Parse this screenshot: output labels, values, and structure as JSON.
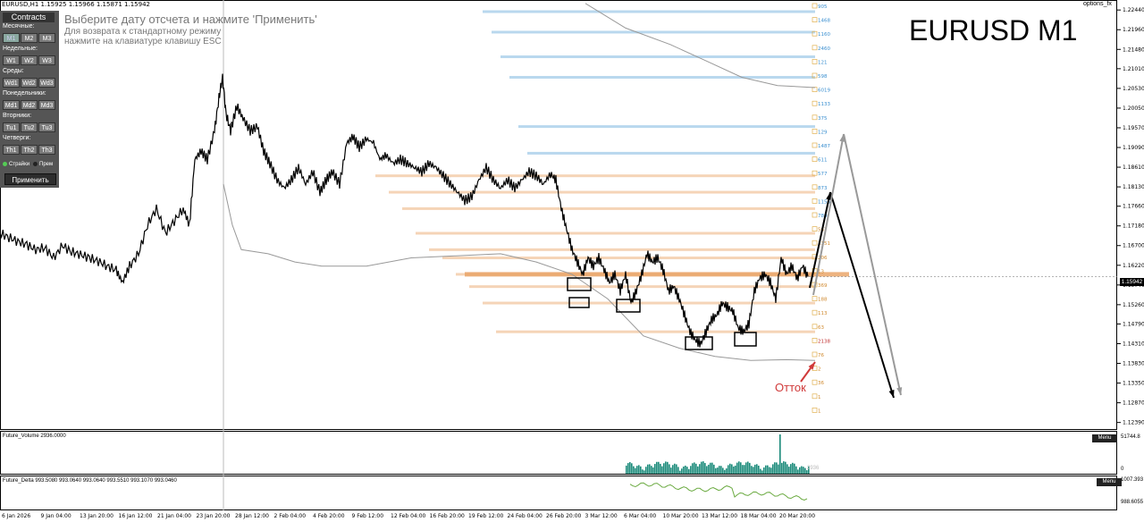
{
  "header": {
    "symbol_line": "EURUSD,H1  1.15925 1.15966 1.15871 1.15942",
    "notice_title": "Выберите дату отсчета и нажмите 'Применить'",
    "notice_line2": "Для возврата к стандартному режиму",
    "notice_line3": "нажмите на клавиатуре клавишу ESC",
    "watermark": "EURUSD M1",
    "options_label": "options_fx"
  },
  "panel": {
    "title": "Contracts",
    "groups": [
      {
        "label": "Месячные:",
        "buttons": [
          "M1",
          "M2",
          "M3"
        ],
        "selected": 0
      },
      {
        "label": "Недельные:",
        "buttons": [
          "W1",
          "W2",
          "W3"
        ],
        "selected": -1
      },
      {
        "label": "Среды:",
        "buttons": [
          "Wd1",
          "Wd2",
          "Wd3"
        ],
        "selected": -1
      },
      {
        "label": "Понедельники:",
        "buttons": [
          "Md1",
          "Md2",
          "Md3"
        ],
        "selected": -1
      },
      {
        "label": "Вторники:",
        "buttons": [
          "Tu1",
          "Tu2",
          "Tu3"
        ],
        "selected": -1
      },
      {
        "label": "Четверги:",
        "buttons": [
          "Th1",
          "Th2",
          "Th3"
        ],
        "selected": -1
      }
    ],
    "radio_strikes": "Страйки",
    "radio_premium": "Прем",
    "apply": "Применить"
  },
  "annotation": {
    "ottok": "Отток"
  },
  "colors": {
    "put": "#e8a060",
    "call": "#80b8e0",
    "price": "#000000",
    "band": "#999999",
    "volume": "#1a8a7a",
    "delta": "#6aaa40"
  },
  "chart_data": {
    "type": "line",
    "symbol": "EURUSD",
    "timeframe": "H1",
    "ohlc_last": {
      "open": 1.15925,
      "high": 1.15966,
      "low": 1.15871,
      "close": 1.15942
    },
    "last_price_label": "1.15942",
    "y_ticks": [
      "1.22440",
      "1.21960",
      "1.21480",
      "1.21010",
      "1.20530",
      "1.20050",
      "1.19570",
      "1.19090",
      "1.18610",
      "1.18130",
      "1.17660",
      "1.17180",
      "1.16700",
      "1.16220",
      "1.15740",
      "1.15260",
      "1.14790",
      "1.14310",
      "1.13830",
      "1.13350",
      "1.12870",
      "1.12390"
    ],
    "ylim": [
      1.1223,
      1.2264
    ],
    "x_ticks": [
      "6 Jan 2026",
      "9 Jan 04:00",
      "13 Jan 20:00",
      "16 Jan 12:00",
      "21 Jan 04:00",
      "23 Jan 20:00",
      "28 Jan 12:00",
      "2 Feb 04:00",
      "4 Feb 20:00",
      "9 Feb 12:00",
      "12 Feb 04:00",
      "16 Feb 20:00",
      "19 Feb 12:00",
      "24 Feb 04:00",
      "26 Feb 20:00",
      "3 Mar 12:00",
      "6 Mar 04:00",
      "10 Mar 20:00",
      "13 Mar 12:00",
      "18 Mar 04:00",
      "20 Mar 20:00"
    ],
    "price_series": [
      [
        0,
        1.17
      ],
      [
        10,
        1.169
      ],
      [
        20,
        1.168
      ],
      [
        30,
        1.1672
      ],
      [
        40,
        1.166
      ],
      [
        50,
        1.1665
      ],
      [
        60,
        1.164
      ],
      [
        70,
        1.167
      ],
      [
        80,
        1.1655
      ],
      [
        90,
        1.1648
      ],
      [
        100,
        1.164
      ],
      [
        110,
        1.1632
      ],
      [
        120,
        1.162
      ],
      [
        130,
        1.161
      ],
      [
        137,
        1.158
      ],
      [
        145,
        1.162
      ],
      [
        155,
        1.165
      ],
      [
        165,
        1.172
      ],
      [
        175,
        1.176
      ],
      [
        185,
        1.17
      ],
      [
        195,
        1.173
      ],
      [
        205,
        1.176
      ],
      [
        212,
        1.172
      ],
      [
        218,
        1.188
      ],
      [
        225,
        1.19
      ],
      [
        232,
        1.188
      ],
      [
        240,
        1.195
      ],
      [
        245,
        1.203
      ],
      [
        249,
        1.208
      ],
      [
        253,
        1.199
      ],
      [
        258,
        1.195
      ],
      [
        265,
        1.201
      ],
      [
        272,
        1.198
      ],
      [
        280,
        1.195
      ],
      [
        288,
        1.196
      ],
      [
        295,
        1.19
      ],
      [
        302,
        1.187
      ],
      [
        310,
        1.183
      ],
      [
        318,
        1.181
      ],
      [
        326,
        1.183
      ],
      [
        334,
        1.186
      ],
      [
        342,
        1.182
      ],
      [
        350,
        1.185
      ],
      [
        358,
        1.18
      ],
      [
        365,
        1.183
      ],
      [
        372,
        1.185
      ],
      [
        380,
        1.182
      ],
      [
        388,
        1.192
      ],
      [
        395,
        1.1935
      ],
      [
        402,
        1.191
      ],
      [
        410,
        1.193
      ],
      [
        418,
        1.192
      ],
      [
        425,
        1.188
      ],
      [
        432,
        1.189
      ],
      [
        440,
        1.187
      ],
      [
        448,
        1.188
      ],
      [
        456,
        1.187
      ],
      [
        464,
        1.186
      ],
      [
        472,
        1.185
      ],
      [
        480,
        1.187
      ],
      [
        488,
        1.186
      ],
      [
        496,
        1.184
      ],
      [
        504,
        1.182
      ],
      [
        512,
        1.18
      ],
      [
        520,
        1.178
      ],
      [
        528,
        1.179
      ],
      [
        536,
        1.183
      ],
      [
        544,
        1.186
      ],
      [
        552,
        1.183
      ],
      [
        560,
        1.181
      ],
      [
        568,
        1.183
      ],
      [
        576,
        1.181
      ],
      [
        584,
        1.183
      ],
      [
        592,
        1.185
      ],
      [
        600,
        1.184
      ],
      [
        608,
        1.182
      ],
      [
        616,
        1.1845
      ],
      [
        622,
        1.183
      ],
      [
        628,
        1.176
      ],
      [
        634,
        1.171
      ],
      [
        640,
        1.166
      ],
      [
        646,
        1.163
      ],
      [
        652,
        1.16
      ],
      [
        658,
        1.164
      ],
      [
        664,
        1.162
      ],
      [
        670,
        1.164
      ],
      [
        676,
        1.161
      ],
      [
        682,
        1.158
      ],
      [
        688,
        1.16
      ],
      [
        694,
        1.156
      ],
      [
        700,
        1.16
      ],
      [
        706,
        1.153
      ],
      [
        712,
        1.156
      ],
      [
        718,
        1.16
      ],
      [
        724,
        1.165
      ],
      [
        730,
        1.163
      ],
      [
        736,
        1.164
      ],
      [
        742,
        1.161
      ],
      [
        748,
        1.156
      ],
      [
        754,
        1.157
      ],
      [
        760,
        1.154
      ],
      [
        766,
        1.15
      ],
      [
        772,
        1.146
      ],
      [
        778,
        1.144
      ],
      [
        784,
        1.143
      ],
      [
        790,
        1.146
      ],
      [
        796,
        1.149
      ],
      [
        802,
        1.15
      ],
      [
        808,
        1.153
      ],
      [
        814,
        1.152
      ],
      [
        820,
        1.151
      ],
      [
        826,
        1.147
      ],
      [
        832,
        1.146
      ],
      [
        838,
        1.148
      ],
      [
        844,
        1.156
      ],
      [
        850,
        1.159
      ],
      [
        856,
        1.16
      ],
      [
        862,
        1.158
      ],
      [
        868,
        1.154
      ],
      [
        874,
        1.164
      ],
      [
        880,
        1.16
      ],
      [
        886,
        1.162
      ],
      [
        892,
        1.159
      ],
      [
        898,
        1.162
      ],
      [
        904,
        1.1594
      ]
    ],
    "band_series": [
      [
        250,
        1.182
      ],
      [
        260,
        1.172
      ],
      [
        270,
        1.166
      ],
      [
        300,
        1.165
      ],
      [
        330,
        1.163
      ],
      [
        360,
        1.162
      ],
      [
        410,
        1.162
      ],
      [
        460,
        1.164
      ],
      [
        510,
        1.1645
      ],
      [
        560,
        1.165
      ],
      [
        600,
        1.163
      ],
      [
        640,
        1.16
      ],
      [
        680,
        1.154
      ],
      [
        720,
        1.145
      ],
      [
        760,
        1.142
      ],
      [
        800,
        1.14
      ],
      [
        840,
        1.139
      ],
      [
        880,
        1.1392
      ],
      [
        912,
        1.139
      ]
    ],
    "band_upper_series": [
      [
        655,
        1.226
      ],
      [
        700,
        1.22
      ],
      [
        750,
        1.216
      ],
      [
        790,
        1.212
      ],
      [
        830,
        1.208
      ],
      [
        870,
        1.206
      ],
      [
        912,
        1.2055
      ]
    ],
    "strike_ladder_labels": [
      "905",
      "1468",
      "1160",
      "2460",
      "121",
      "598",
      "6019",
      "1133",
      "375",
      "129",
      "1487",
      "611",
      "577",
      "873",
      "1156",
      "780",
      "567",
      "1351",
      "206",
      "13",
      "369",
      "188",
      "113",
      "63",
      "2138",
      "76",
      "2",
      "36",
      "1",
      "1"
    ],
    "boxes_note": "5 rectangles around local lows",
    "volume_panel": {
      "title": "Future_Volume 2936.0000",
      "y_max": "51744.8",
      "y_min": "0",
      "menu": "Menu",
      "last_label": "2936"
    },
    "delta_panel": {
      "title": "Future_Delta 993.5080 993.0640 993.0640 993.5510 993.1070 993.0460",
      "y_max": "1007.393",
      "y_min": "988.6055",
      "menu": "Menu"
    }
  }
}
